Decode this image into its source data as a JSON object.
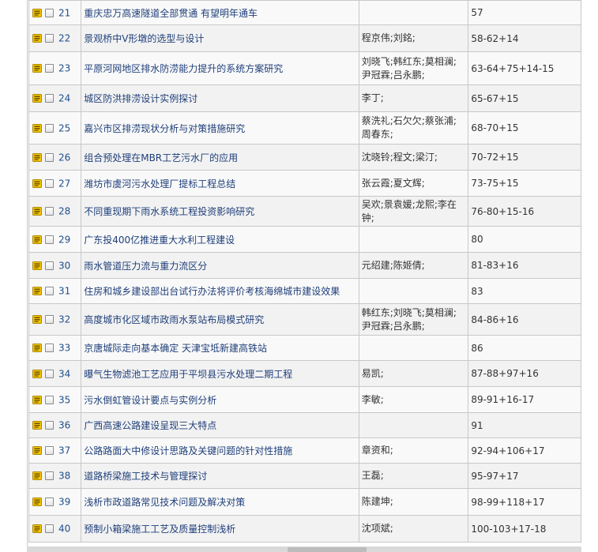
{
  "rows": [
    {
      "no": "21",
      "title": "重庆忠万高速隧道全部贯通  有望明年通车",
      "authors": "",
      "pages": "57"
    },
    {
      "no": "22",
      "title": "景观桥中V形墩的选型与设计",
      "authors": "程京伟;刘銘;",
      "pages": "58-62+14"
    },
    {
      "no": "23",
      "title": "平原河网地区排水防涝能力提升的系统方案研究",
      "authors": "刘晓飞;韩红东;莫相澜;尹冠霖;吕永鹏;",
      "pages": "63-64+75+14-15"
    },
    {
      "no": "24",
      "title": "城区防洪排涝设计实例探讨",
      "authors": "李丁;",
      "pages": "65-67+15"
    },
    {
      "no": "25",
      "title": "嘉兴市区排涝现状分析与对策措施研究",
      "authors": "蔡洗礼;石欠欠;蔡张浦;周春东;",
      "pages": "68-70+15"
    },
    {
      "no": "26",
      "title": "组合预处理在MBR工艺污水厂的应用",
      "authors": "沈晓铃;程文;梁汀;",
      "pages": "70-72+15"
    },
    {
      "no": "27",
      "title": "潍坊市虞河污水处理厂提标工程总结",
      "authors": "张云霞;夏文辉;",
      "pages": "73-75+15"
    },
    {
      "no": "28",
      "title": "不同重现期下雨水系统工程投资影响研究",
      "authors": "吴欢;景袁媛;龙熙;李在钟;",
      "pages": "76-80+15-16"
    },
    {
      "no": "29",
      "title": "广东投400亿推进重大水利工程建设",
      "authors": "",
      "pages": "80"
    },
    {
      "no": "30",
      "title": "雨水管道压力流与重力流区分",
      "authors": "元绍建;陈姬倩;",
      "pages": "81-83+16"
    },
    {
      "no": "31",
      "title": "住房和城乡建设部出台试行办法将评价考核海绵城市建设效果",
      "authors": "",
      "pages": "83"
    },
    {
      "no": "32",
      "title": "高度城市化区域市政雨水泵站布局模式研究",
      "authors": "韩红东;刘晓飞;莫相澜;尹冠霖;吕永鹏;",
      "pages": "84-86+16"
    },
    {
      "no": "33",
      "title": "京唐城际走向基本确定  天津宝坻新建高铁站",
      "authors": "",
      "pages": "86"
    },
    {
      "no": "34",
      "title": "曝气生物滤池工艺应用于平坝县污水处理二期工程",
      "authors": "易凯;",
      "pages": "87-88+97+16"
    },
    {
      "no": "35",
      "title": "污水倒虹管设计要点与实例分析",
      "authors": "李敏;",
      "pages": "89-91+16-17"
    },
    {
      "no": "36",
      "title": "广西高速公路建设呈现三大特点",
      "authors": "",
      "pages": "91"
    },
    {
      "no": "37",
      "title": "公路路面大中修设计思路及关键问题的针对性措施",
      "authors": "章资和;",
      "pages": "92-94+106+17"
    },
    {
      "no": "38",
      "title": "道路桥梁施工技术与管理探讨",
      "authors": "王磊;",
      "pages": "95-97+17"
    },
    {
      "no": "39",
      "title": "浅析市政道路常见技术问题及解决对策",
      "authors": "陈建坤;",
      "pages": "98-99+118+17"
    },
    {
      "no": "40",
      "title": "预制小箱梁施工工艺及质量控制浅析",
      "authors": "沈项斌;",
      "pages": "100-103+17-18"
    }
  ],
  "colors": {
    "link": "#1f3f7a",
    "number": "#1f4e8c",
    "icon": "#f2c200",
    "border": "#c8c8c8"
  },
  "icons": {
    "row_icon": "document-stack-icon"
  }
}
